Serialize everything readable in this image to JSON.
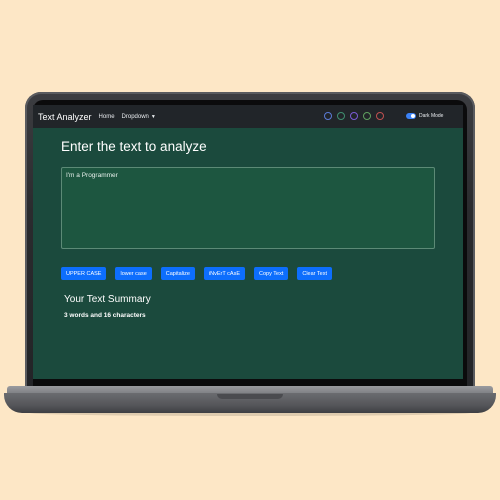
{
  "navbar": {
    "brand": "Text Analyzer",
    "links": [
      {
        "label": "Home"
      },
      {
        "label": "Dropdown"
      }
    ],
    "theme_colors": [
      "#5b7bd5",
      "#3f8f6f",
      "#7b5bd5",
      "#5fa05f",
      "#c05050"
    ],
    "dark_mode_label": "Dark Mode",
    "dark_mode_on": true
  },
  "main": {
    "heading": "Enter the text to analyze",
    "textarea_value": "I'm a Programmer",
    "buttons": [
      {
        "label": "UPPER CASE"
      },
      {
        "label": "lower case"
      },
      {
        "label": "Capitalize"
      },
      {
        "label": "iNvErT cAsE"
      },
      {
        "label": "Copy Text"
      },
      {
        "label": "Clear Text"
      }
    ],
    "summary_title": "Your Text Summary",
    "summary_text": "3 words and 16 characters"
  },
  "colors": {
    "page_background": "#fde7c6",
    "screen_background": "#1b4a3d",
    "navbar": "#212529",
    "button": "#0d6efd"
  }
}
